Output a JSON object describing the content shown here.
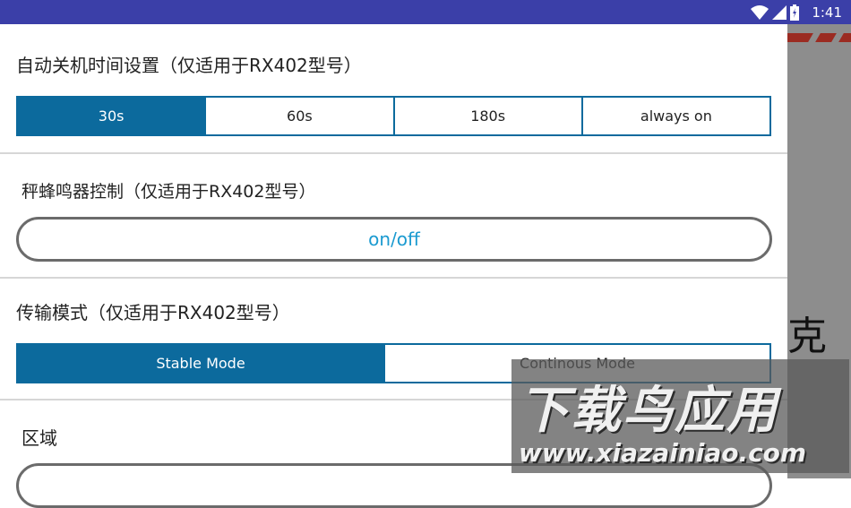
{
  "status_bar": {
    "time": "1:41",
    "icons": [
      "wifi-icon",
      "signal-icon",
      "battery-icon"
    ]
  },
  "sections": {
    "auto_shutdown": {
      "title": "自动关机时间设置（仅适用于RX402型号）",
      "options": [
        "30s",
        "60s",
        "180s",
        "always on"
      ],
      "selected": "30s"
    },
    "buzzer": {
      "title": "秤蜂鸣器控制（仅适用于RX402型号）",
      "button_label": "on/off"
    },
    "transfer_mode": {
      "title": "传输模式（仅适用于RX402型号）",
      "options": [
        "Stable Mode",
        "Continous Mode"
      ],
      "selected": "Stable Mode"
    },
    "region": {
      "title": "区域"
    }
  },
  "background": {
    "partial_char": "克"
  },
  "watermark": {
    "title": "下载鸟应用",
    "url": "www.xiazainiao.com"
  },
  "colors": {
    "status_bar": "#3b3fa8",
    "accent": "#0c6a9d",
    "pill_text": "#1a9ad0"
  }
}
